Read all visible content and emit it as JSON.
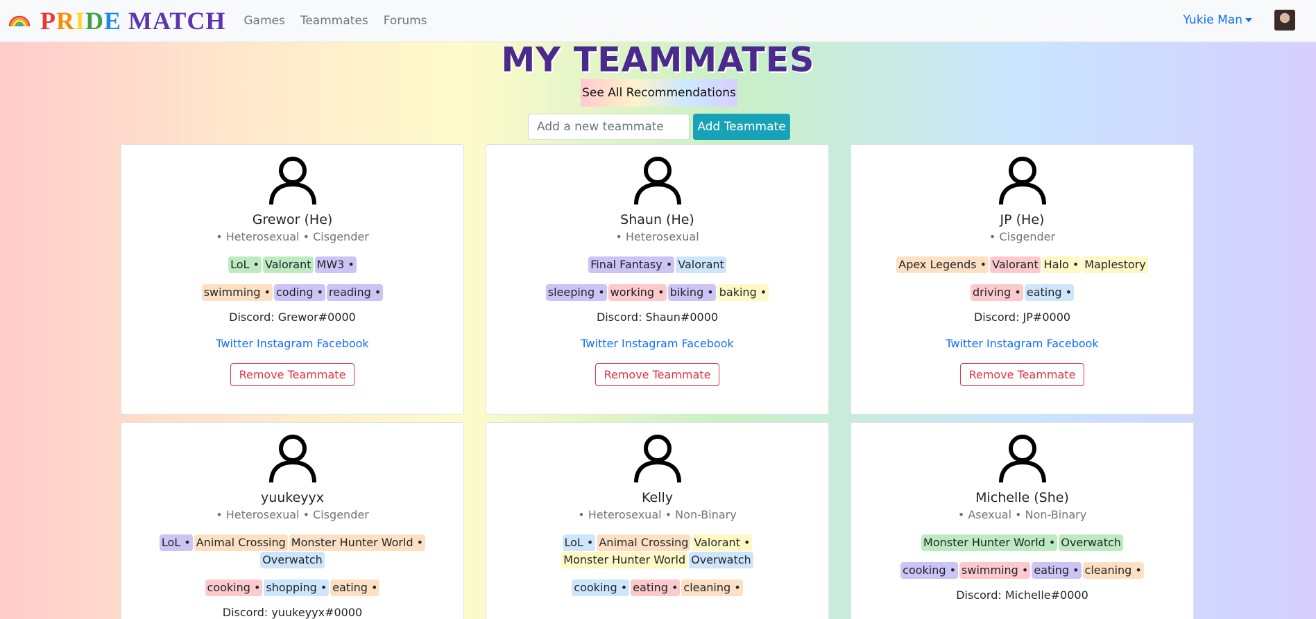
{
  "nav": {
    "brand_letters": [
      "P",
      "R",
      "I",
      "D",
      "E",
      " ",
      "M",
      "A",
      "T",
      "C",
      "H"
    ],
    "links": [
      "Games",
      "Teammates",
      "Forums"
    ],
    "user": "Yukie Man"
  },
  "page": {
    "title": "MY TEAMMATES",
    "recs_button": "See All Recommendations",
    "add_placeholder": "Add a new teammate",
    "add_button": "Add Teammate"
  },
  "tag_colors": {
    "green": "#bdeac0",
    "purple": "#cbc4f5",
    "orange": "#fde0c4",
    "blue": "#cde6fb",
    "yellow": "#fdf8c4",
    "pink": "#fcc9cc"
  },
  "social_labels": [
    "Twitter",
    "Instagram",
    "Facebook"
  ],
  "remove_label": "Remove Teammate",
  "teammates": [
    {
      "name": "Grewor (He)",
      "identity": "• Heterosexual • Cisgender",
      "games": [
        [
          "LoL •",
          "green"
        ],
        [
          "Valorant",
          "green"
        ],
        [
          "MW3 •",
          "purple"
        ]
      ],
      "hobbies": [
        [
          "swimming •",
          "orange"
        ],
        [
          "coding •",
          "purple"
        ],
        [
          "reading •",
          "purple"
        ]
      ],
      "discord": "Discord: Grewor#0000"
    },
    {
      "name": "Shaun (He)",
      "identity": "• Heterosexual",
      "games": [
        [
          "Final Fantasy •",
          "purple"
        ],
        [
          "Valorant",
          "blue"
        ]
      ],
      "hobbies": [
        [
          "sleeping •",
          "purple"
        ],
        [
          "working •",
          "pink"
        ],
        [
          "biking •",
          "purple"
        ],
        [
          "baking •",
          "yellow"
        ]
      ],
      "discord": "Discord: Shaun#0000"
    },
    {
      "name": "JP (He)",
      "identity": "• Cisgender",
      "games": [
        [
          "Apex Legends •",
          "orange"
        ],
        [
          "Valorant",
          "pink"
        ],
        [
          "Halo •",
          "yellow"
        ],
        [
          "Maplestory",
          "yellow"
        ]
      ],
      "hobbies": [
        [
          "driving •",
          "pink"
        ],
        [
          "eating •",
          "blue"
        ]
      ],
      "discord": "Discord: JP#0000"
    },
    {
      "name": "yuukeyyx",
      "identity": "• Heterosexual • Cisgender",
      "games": [
        [
          "LoL •",
          "purple"
        ],
        [
          "Animal Crossing",
          "orange"
        ],
        [
          "Monster Hunter World •",
          "orange"
        ],
        [
          "Overwatch",
          "blue"
        ]
      ],
      "hobbies": [
        [
          "cooking •",
          "pink"
        ],
        [
          "shopping •",
          "blue"
        ],
        [
          "eating •",
          "orange"
        ]
      ],
      "discord": "Discord: yuukeyyx#0000"
    },
    {
      "name": "Kelly",
      "identity": "• Heterosexual • Non-Binary",
      "games": [
        [
          "LoL •",
          "blue"
        ],
        [
          "Animal Crossing",
          "orange"
        ],
        [
          "Valorant •",
          "yellow"
        ],
        [
          "Monster Hunter World",
          "yellow"
        ],
        [
          "Overwatch",
          "blue"
        ]
      ],
      "hobbies": [
        [
          "cooking •",
          "blue"
        ],
        [
          "eating •",
          "pink"
        ],
        [
          "cleaning •",
          "orange"
        ]
      ],
      "discord": ""
    },
    {
      "name": "Michelle (She)",
      "identity": "• Asexual • Non-Binary",
      "games": [
        [
          "Monster Hunter World •",
          "green"
        ],
        [
          "Overwatch",
          "green"
        ]
      ],
      "hobbies": [
        [
          "cooking •",
          "purple"
        ],
        [
          "swimming •",
          "pink"
        ],
        [
          "eating •",
          "purple"
        ],
        [
          "cleaning •",
          "orange"
        ]
      ],
      "discord": "Discord: Michelle#0000"
    }
  ]
}
